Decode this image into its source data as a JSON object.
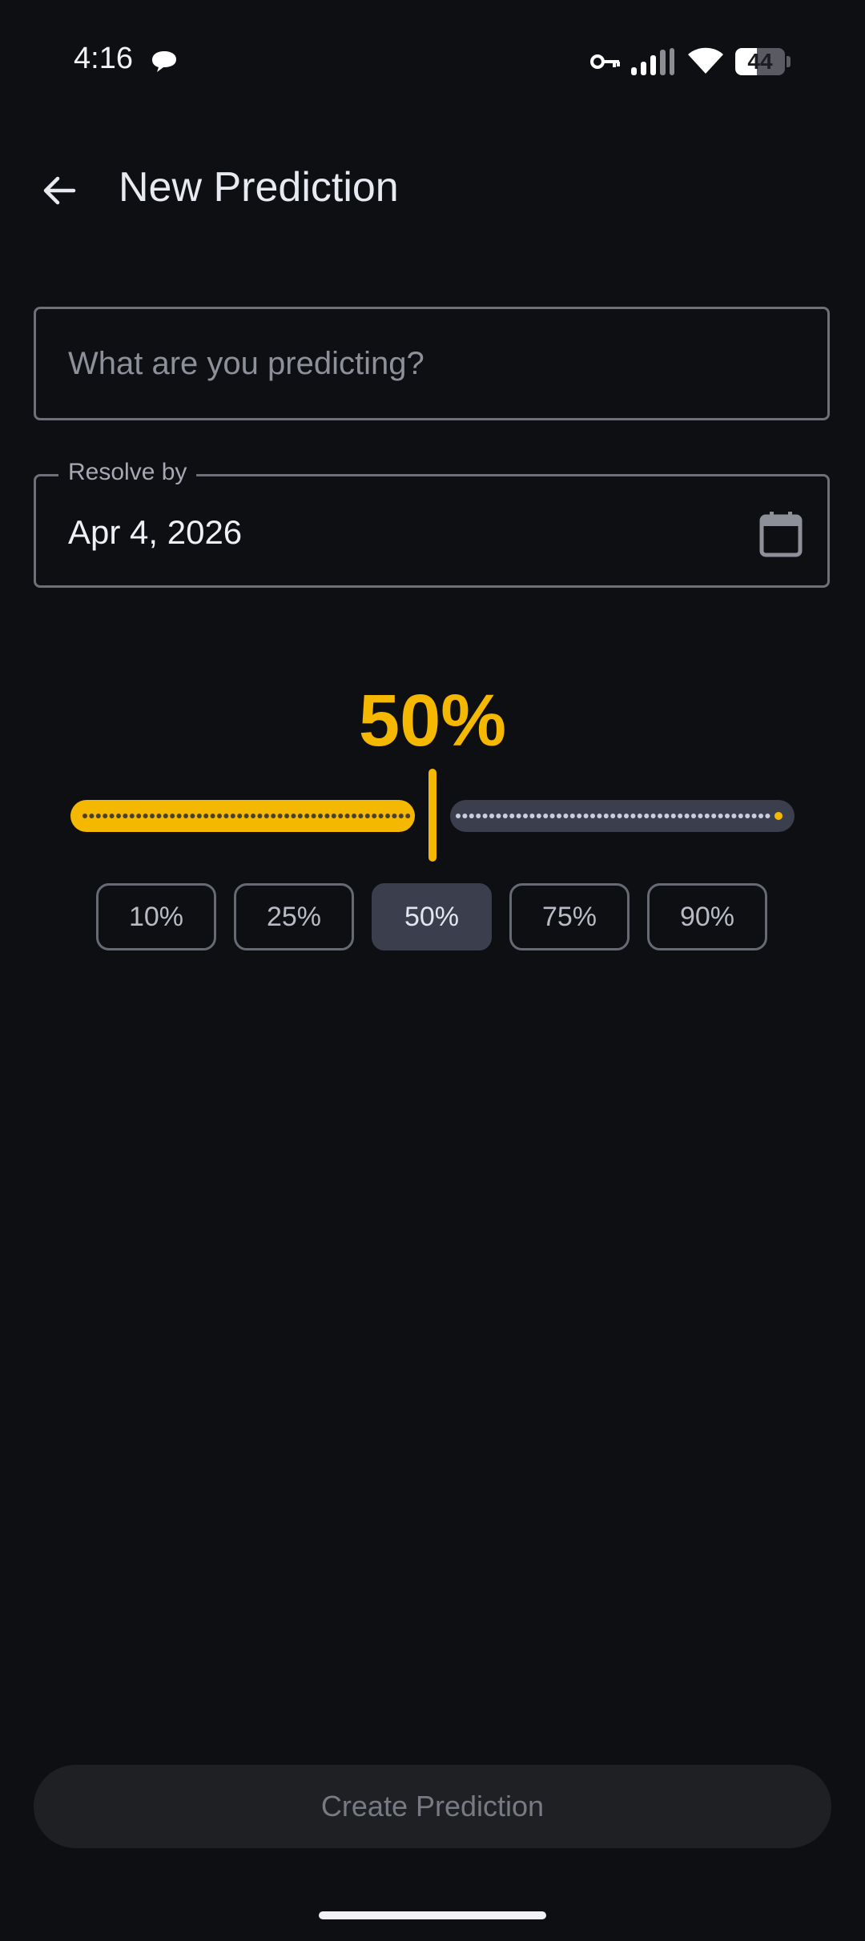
{
  "status_bar": {
    "time": "4:16",
    "battery_level": "44",
    "battery_fraction": 0.44,
    "icons": [
      "chat-bubble-icon",
      "vpn-key-icon",
      "cell-signal-icon",
      "wifi-icon",
      "battery-icon"
    ]
  },
  "app_bar": {
    "title": "New Prediction",
    "back_icon": "arrow-back-icon"
  },
  "form": {
    "question": {
      "placeholder": "What are you predicting?",
      "value": ""
    },
    "resolve_date": {
      "label": "Resolve by",
      "value": "Apr 4, 2026",
      "icon": "calendar-icon"
    }
  },
  "probability": {
    "display": "50%",
    "value": 0.5,
    "presets": [
      {
        "label": "10%",
        "selected": false
      },
      {
        "label": "25%",
        "selected": false
      },
      {
        "label": "50%",
        "selected": true
      },
      {
        "label": "75%",
        "selected": false
      },
      {
        "label": "90%",
        "selected": false
      }
    ]
  },
  "actions": {
    "create_label": "Create Prediction",
    "create_enabled": false
  },
  "colors": {
    "background": "#0e0f13",
    "accent": "#f5b800",
    "track_inactive": "#3a3e4d",
    "chip_selected": "#3a3e4d",
    "button_disabled": "#1f2024"
  }
}
